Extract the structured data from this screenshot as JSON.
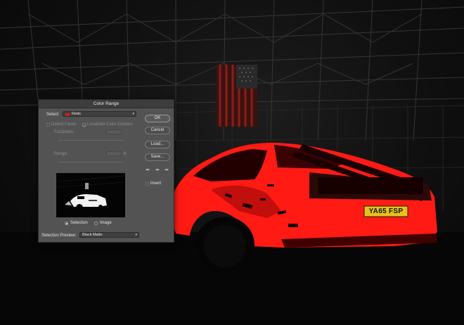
{
  "dialog": {
    "title": "Color Range",
    "select_label": "Select:",
    "select_value": "Reds",
    "select_swatch_color": "#d21a1a",
    "detect_faces_label": "Detect Faces",
    "detect_faces_checked": false,
    "localized_label": "Localized Color Clusters",
    "localized_checked": true,
    "fuzziness_label": "Fuzziness:",
    "range_label": "Range:",
    "range_unit": "%",
    "ok_label": "OK",
    "cancel_label": "Cancel",
    "load_label": "Load...",
    "save_label": "Save...",
    "invert_label": "Invert",
    "invert_checked": false,
    "radio_selection_label": "Selection",
    "radio_image_label": "Image",
    "radio_selected": "Selection",
    "preview_label": "Selection Preview:",
    "preview_value": "Black Matte"
  },
  "photo": {
    "plate_text": "YA65 FSP",
    "car_color": "#ff1a14"
  }
}
